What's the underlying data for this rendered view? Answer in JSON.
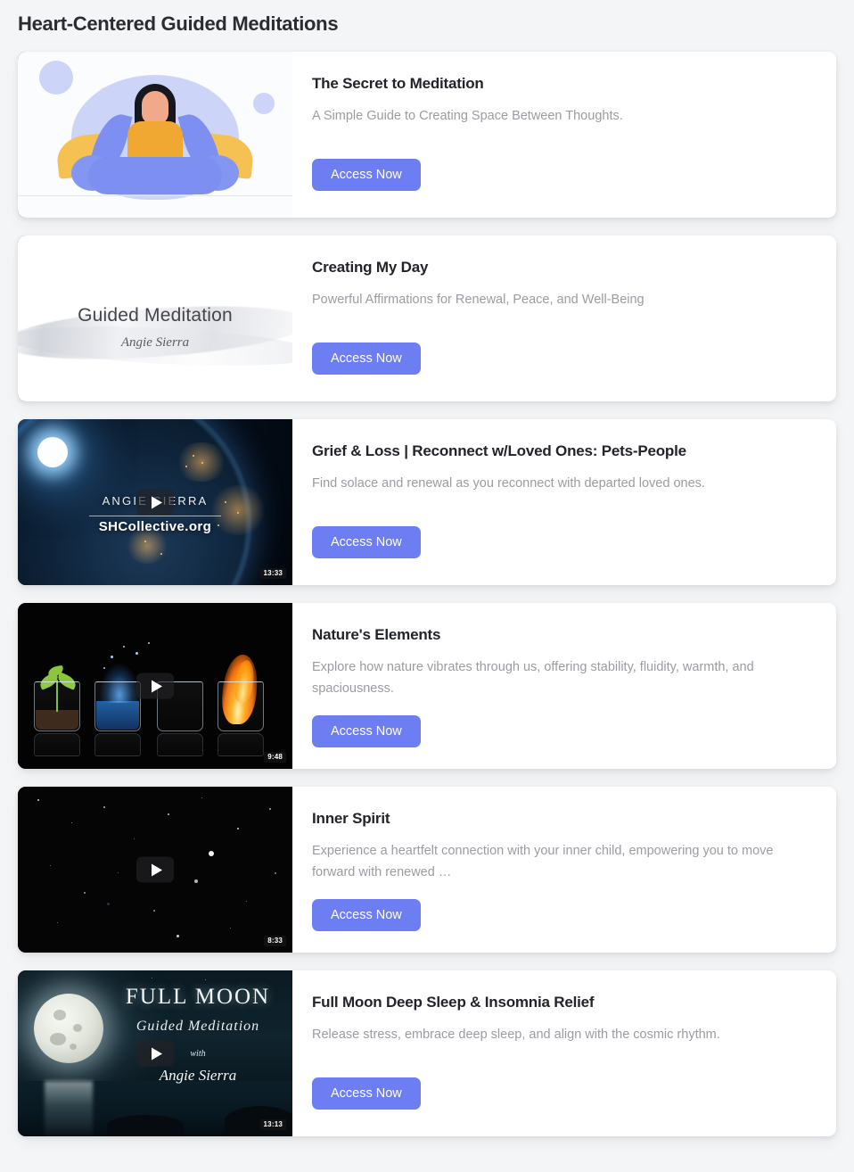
{
  "page": {
    "title": "Heart-Centered Guided Meditations",
    "accent_color": "#6d7ef2",
    "background_color": "#f4f5f7"
  },
  "cards": [
    {
      "title": "The Secret to Meditation",
      "description": "A Simple Guide to Creating Space Between Thoughts.",
      "button_label": "Access Now",
      "thumbnail": {
        "kind": "illustration",
        "art_name": "woman-meditating-lotus-illustration",
        "has_play_button": false,
        "duration": ""
      }
    },
    {
      "title": "Creating My Day",
      "description": "Powerful Affirmations for Renewal, Peace, and Well-Being",
      "button_label": "Access Now",
      "thumbnail": {
        "kind": "title-card",
        "art_name": "guided-meditation-white-title-card",
        "has_play_button": false,
        "duration": "",
        "overlay_title": "Guided Meditation",
        "overlay_author": "Angie Sierra"
      }
    },
    {
      "title": "Grief & Loss | Reconnect w/Loved Ones: Pets-People",
      "description": "Find solace and renewal as you reconnect with departed loved ones.",
      "button_label": "Access Now",
      "thumbnail": {
        "kind": "video",
        "art_name": "earth-from-space-sunrise",
        "has_play_button": true,
        "duration": "13:33",
        "overlay_brand": "ANGIE SIERRA",
        "overlay_site": "SHCollective.org"
      }
    },
    {
      "title": "Nature's Elements",
      "description": "Explore how nature vibrates through us, offering stability, fluidity, warmth, and spaciousness.",
      "button_label": "Access Now",
      "thumbnail": {
        "kind": "video",
        "art_name": "four-glasses-earth-water-air-fire",
        "has_play_button": true,
        "duration": "9:48"
      }
    },
    {
      "title": "Inner Spirit",
      "description": "Experience a heartfelt connection with your inner child, empowering you to move forward with renewed …",
      "button_label": "Access Now",
      "thumbnail": {
        "kind": "video",
        "art_name": "starfield-night-sky",
        "has_play_button": true,
        "duration": "8:33"
      }
    },
    {
      "title": "Full Moon Deep Sleep & Insomnia Relief",
      "description": "Release stress, embrace deep sleep, and align with the cosmic rhythm.",
      "button_label": "Access Now",
      "thumbnail": {
        "kind": "video",
        "art_name": "full-moon-over-water",
        "has_play_button": true,
        "duration": "13:13",
        "overlay_line1": "FULL MOON",
        "overlay_line2": "Guided Meditation",
        "overlay_line3": "with",
        "overlay_line4": "Angie Sierra"
      }
    }
  ]
}
